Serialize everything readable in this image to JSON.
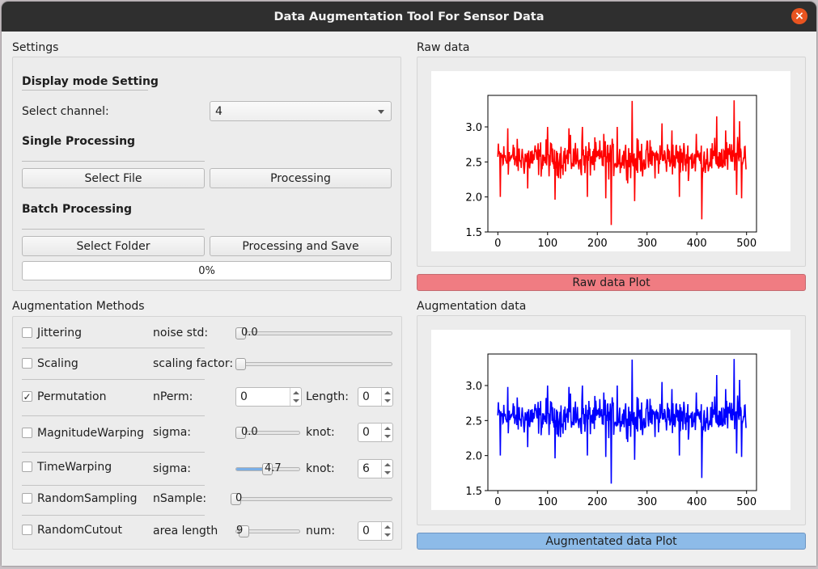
{
  "window": {
    "title": "Data Augmentation Tool For Sensor Data"
  },
  "settings": {
    "group_title": "Settings",
    "display_mode_title": "Display mode Setting",
    "select_channel_label": "Select channel:",
    "channel_value": "4",
    "single_title": "Single Processing",
    "select_file": "Select File",
    "processing": "Processing",
    "batch_title": "Batch Processing",
    "select_folder": "Select Folder",
    "processing_save": "Processing and Save",
    "progress_text": "0%",
    "progress_value": 0
  },
  "augmentation": {
    "group_title": "Augmentation Methods",
    "jittering": {
      "label": "Jittering",
      "checked": false,
      "param_label": "noise std:",
      "slider_text": "0.0",
      "slider_fraction": 0.0
    },
    "scaling": {
      "label": "Scaling",
      "checked": false,
      "param_label": "scaling factor:",
      "slider_fraction": 0.0
    },
    "permutation": {
      "label": "Permutation",
      "checked": true,
      "checkmark": "✓",
      "param_label": "nPerm:",
      "nperm_value": "0",
      "length_label": "Length:",
      "length_value": "0"
    },
    "magnitude": {
      "label": "MagnitudeWarping",
      "checked": false,
      "param_label": "sigma:",
      "slider_text": "0.0",
      "slider_fraction": 0.0,
      "knot_label": "knot:",
      "knot_value": "0"
    },
    "timewarp": {
      "label": "TimeWarping",
      "checked": false,
      "param_label": "sigma:",
      "slider_text": "4.7",
      "slider_fraction": 0.47,
      "knot_label": "knot:",
      "knot_value": "6"
    },
    "randsample": {
      "label": "RandomSampling",
      "checked": false,
      "param_label": "nSample:",
      "slider_text": "0",
      "slider_fraction": 0.0
    },
    "randcutout": {
      "label": "RandomCutout",
      "checked": false,
      "param_label": "area length",
      "slider_text": "9",
      "slider_fraction": 0.05,
      "num_label": "num:",
      "num_value": "0"
    }
  },
  "raw_panel": {
    "title": "Raw data",
    "button": "Raw data Plot",
    "button_color": "#f07c82",
    "line_color": "#ff0000"
  },
  "aug_panel": {
    "title": "Augmentation data",
    "button": "Augmentated data Plot",
    "button_color": "#8dbbe8",
    "line_color": "#0000ff"
  },
  "chart_data": [
    {
      "type": "line",
      "name": "raw",
      "xlim": [
        -20,
        520
      ],
      "ylim": [
        1.5,
        3.45
      ],
      "xticks": [
        0,
        100,
        200,
        300,
        400,
        500
      ],
      "yticks": [
        1.5,
        2.0,
        2.5,
        3.0
      ],
      "x_tick_labels": [
        "0",
        "100",
        "200",
        "300",
        "400",
        "500"
      ],
      "y_tick_labels": [
        "1.5",
        "2.0",
        "2.5",
        "3.0"
      ],
      "color": "#ff0000",
      "n_points": 500,
      "mean": 2.55,
      "spikes": [
        [
          5,
          2.0
        ],
        [
          20,
          2.98
        ],
        [
          60,
          2.12
        ],
        [
          100,
          3.0
        ],
        [
          115,
          1.96
        ],
        [
          143,
          2.98
        ],
        [
          170,
          3.0
        ],
        [
          180,
          2.0
        ],
        [
          213,
          2.9
        ],
        [
          217,
          1.98
        ],
        [
          228,
          1.6
        ],
        [
          240,
          3.0
        ],
        [
          270,
          3.37
        ],
        [
          275,
          1.94
        ],
        [
          330,
          3.05
        ],
        [
          350,
          2.95
        ],
        [
          365,
          2.0
        ],
        [
          399,
          2.9
        ],
        [
          410,
          1.68
        ],
        [
          440,
          3.15
        ],
        [
          458,
          2.95
        ],
        [
          475,
          3.38
        ],
        [
          480,
          2.03
        ],
        [
          486,
          3.08
        ],
        [
          490,
          1.98
        ],
        [
          497,
          2.72
        ]
      ]
    },
    {
      "type": "line",
      "name": "augmented",
      "xlim": [
        -20,
        520
      ],
      "ylim": [
        1.5,
        3.45
      ],
      "xticks": [
        0,
        100,
        200,
        300,
        400,
        500
      ],
      "yticks": [
        1.5,
        2.0,
        2.5,
        3.0
      ],
      "x_tick_labels": [
        "0",
        "100",
        "200",
        "300",
        "400",
        "500"
      ],
      "y_tick_labels": [
        "1.5",
        "2.0",
        "2.5",
        "3.0"
      ],
      "color": "#0000ff",
      "n_points": 500,
      "mean": 2.55,
      "spikes": [
        [
          5,
          2.0
        ],
        [
          20,
          2.98
        ],
        [
          60,
          2.12
        ],
        [
          100,
          3.0
        ],
        [
          115,
          1.96
        ],
        [
          143,
          2.98
        ],
        [
          170,
          3.0
        ],
        [
          180,
          2.0
        ],
        [
          213,
          2.9
        ],
        [
          217,
          1.98
        ],
        [
          228,
          1.6
        ],
        [
          240,
          3.0
        ],
        [
          270,
          3.37
        ],
        [
          275,
          1.94
        ],
        [
          330,
          3.05
        ],
        [
          350,
          2.95
        ],
        [
          365,
          2.0
        ],
        [
          399,
          2.9
        ],
        [
          410,
          1.68
        ],
        [
          440,
          3.15
        ],
        [
          458,
          2.95
        ],
        [
          475,
          3.38
        ],
        [
          480,
          2.03
        ],
        [
          486,
          3.08
        ],
        [
          490,
          1.98
        ],
        [
          497,
          2.72
        ]
      ]
    }
  ]
}
